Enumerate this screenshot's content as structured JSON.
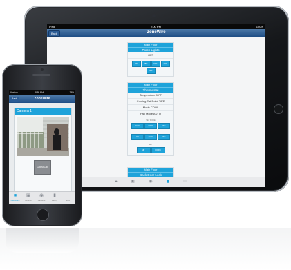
{
  "ipad": {
    "status": {
      "left": "iPad",
      "time": "2:00 PM",
      "battery": "100%"
    },
    "nav": {
      "back": "Back",
      "title": "ZoneWire"
    },
    "cards": [
      {
        "header": "Main Floor",
        "title": "Porch Lights",
        "rows": [
          "OFF"
        ],
        "buttons": [
          "ON",
          "25%",
          "50%",
          "75%",
          "OFF"
        ]
      },
      {
        "header": "Main Floor",
        "title": "Thermostat",
        "rows": [
          "Temperature 80°F",
          "Cooling Set Point 78°F",
          "Mode COOL",
          "Fan Mode AUTO"
        ],
        "set_mode_label": "SET MODE",
        "mode_buttons": [
          "AUTO",
          "COOL",
          "OFF"
        ],
        "fan_buttons": [
          "ON",
          "AUTO",
          "OFF"
        ],
        "set_label": "SET",
        "set_buttons": [
          "UP",
          "DOWN"
        ]
      },
      {
        "header": "Main Floor",
        "title": "Back Door Lock"
      }
    ]
  },
  "iphone": {
    "status": {
      "carrier": "Verizon",
      "time": "8:59 PM",
      "battery": "75%"
    },
    "nav": {
      "back": "Back",
      "title": "ZoneWire"
    },
    "camera_title": "Camera 1",
    "clip_button": "Latest Clip",
    "tabs": [
      {
        "label": "Dashboard",
        "icon": "lock-icon",
        "active": true
      },
      {
        "label": "Devices",
        "icon": "devices-icon",
        "active": false
      },
      {
        "label": "Cameras",
        "icon": "camera-icon",
        "active": false
      },
      {
        "label": "History",
        "icon": "history-icon",
        "active": false
      },
      {
        "label": "More",
        "icon": "more-icon",
        "active": false
      }
    ]
  },
  "colors": {
    "accent": "#1ea3da",
    "nav_bar": "#2a5a92",
    "device_body": "#1a1b1e"
  }
}
